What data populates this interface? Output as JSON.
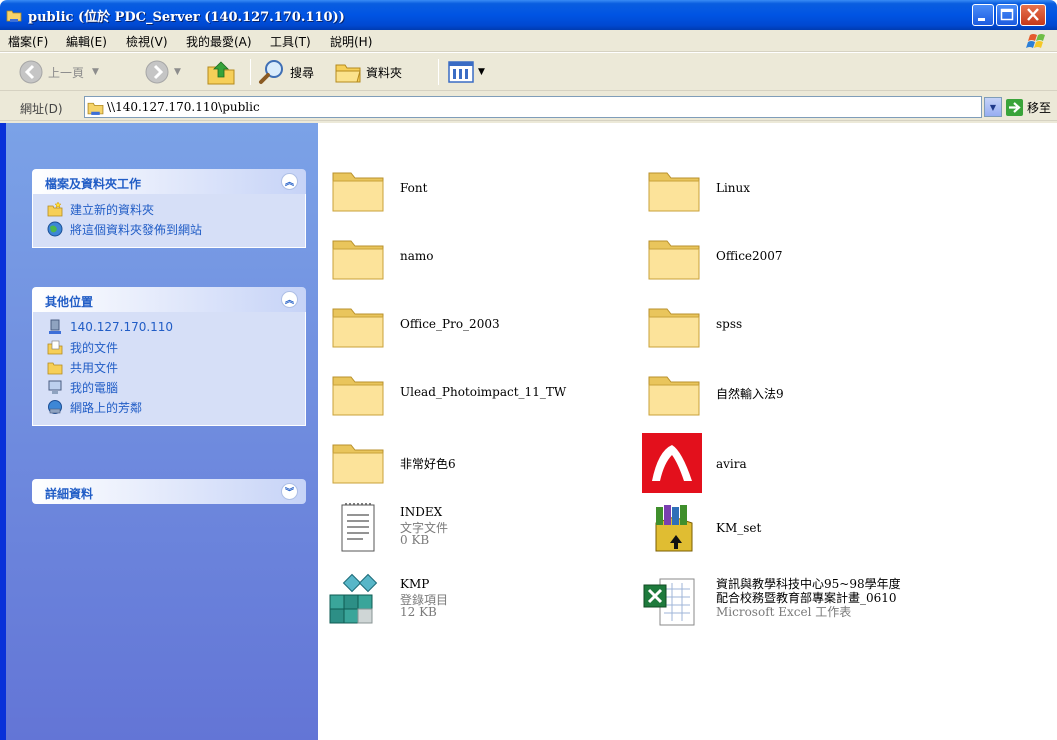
{
  "window": {
    "title": "public (位於 PDC_Server (140.127.170.110))"
  },
  "menu": {
    "items": [
      "檔案(F)",
      "編輯(E)",
      "檢視(V)",
      "我的最愛(A)",
      "工具(T)",
      "說明(H)"
    ]
  },
  "toolbar": {
    "back_label": "上一頁",
    "search_label": "搜尋",
    "folders_label": "資料夾"
  },
  "address": {
    "label": "網址(D)",
    "value": "\\\\140.127.170.110\\public",
    "go_label": "移至"
  },
  "taskpane": {
    "file_tasks": {
      "header": "檔案及資料夾工作",
      "items": [
        {
          "label": "建立新的資料夾",
          "icon": "new-folder-icon"
        },
        {
          "label": "將這個資料夾發佈到網站",
          "icon": "publish-web-icon"
        }
      ]
    },
    "other_places": {
      "header": "其他位置",
      "items": [
        {
          "label": "140.127.170.110",
          "icon": "network-computer-icon"
        },
        {
          "label": "我的文件",
          "icon": "my-documents-icon"
        },
        {
          "label": "共用文件",
          "icon": "shared-documents-icon"
        },
        {
          "label": "我的電腦",
          "icon": "my-computer-icon"
        },
        {
          "label": "網路上的芳鄰",
          "icon": "network-places-icon"
        }
      ]
    },
    "details": {
      "header": "詳細資料"
    }
  },
  "files": [
    {
      "name": "Font",
      "type": "folder"
    },
    {
      "name": "Linux",
      "type": "folder"
    },
    {
      "name": "namo",
      "type": "folder"
    },
    {
      "name": "Office2007",
      "type": "folder"
    },
    {
      "name": "Office_Pro_2003",
      "type": "folder"
    },
    {
      "name": "spss",
      "type": "folder"
    },
    {
      "name": "Ulead_Photoimpact_11_TW",
      "type": "folder"
    },
    {
      "name": "自然輸入法9",
      "type": "folder"
    },
    {
      "name": "非常好色6",
      "type": "folder"
    },
    {
      "name": "avira",
      "type": "shortcut"
    },
    {
      "name": "INDEX",
      "line2": "文字文件",
      "line3": "0 KB",
      "type": "text-file"
    },
    {
      "name": "KM_set",
      "type": "installer"
    },
    {
      "name": "KMP",
      "line2": "登錄項目",
      "line3": "12 KB",
      "type": "registry-file"
    },
    {
      "name": "資訊與教學科技中心95~98學年度",
      "name2": "配合校務暨教育部專案計畫_0610",
      "line3": "Microsoft Excel 工作表",
      "type": "excel-file"
    }
  ],
  "colors": {
    "titlebar": "#0054e3",
    "taskpane_bg": "#6375d6",
    "taskpane_link": "#215dc6",
    "folder_fill": "#fce39a"
  }
}
